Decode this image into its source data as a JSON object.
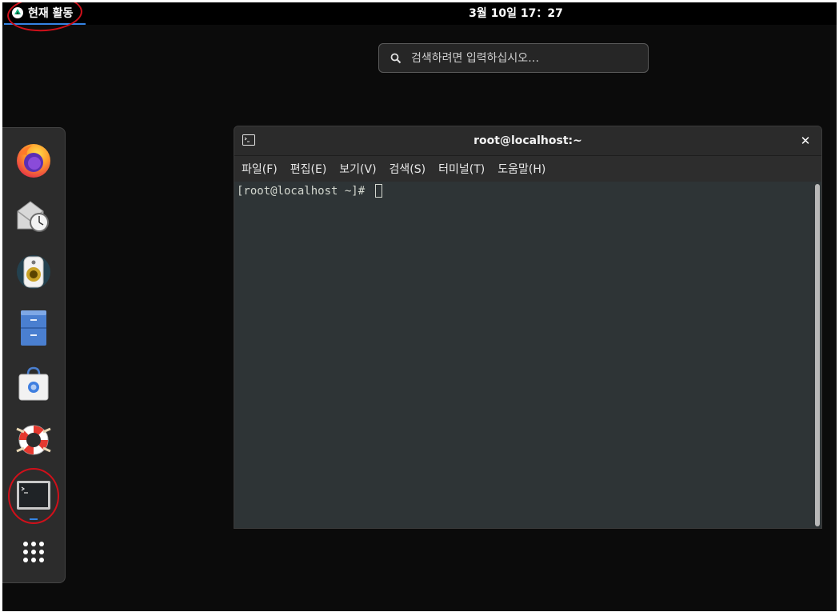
{
  "topbar": {
    "activities_label": "현재 활동",
    "clock": "3월 10일  17：27"
  },
  "search": {
    "placeholder": "검색하려면 입력하십시오…"
  },
  "dock": {
    "items": [
      {
        "name": "firefox",
        "running": false
      },
      {
        "name": "evolution-mail",
        "running": false
      },
      {
        "name": "rhythmbox",
        "running": false
      },
      {
        "name": "files",
        "running": false
      },
      {
        "name": "software",
        "running": false
      },
      {
        "name": "help",
        "running": false
      },
      {
        "name": "terminal",
        "running": true
      },
      {
        "name": "show-applications",
        "running": false
      }
    ]
  },
  "terminal": {
    "title": "root@localhost:~",
    "close_glyph": "✕",
    "menu": [
      "파일(F)",
      "편집(E)",
      "보기(V)",
      "검색(S)",
      "터미널(T)",
      "도움말(H)"
    ],
    "prompt": "[root@localhost ~]# "
  },
  "colors": {
    "accent": "#3584e4",
    "annotation": "#d0101a"
  }
}
